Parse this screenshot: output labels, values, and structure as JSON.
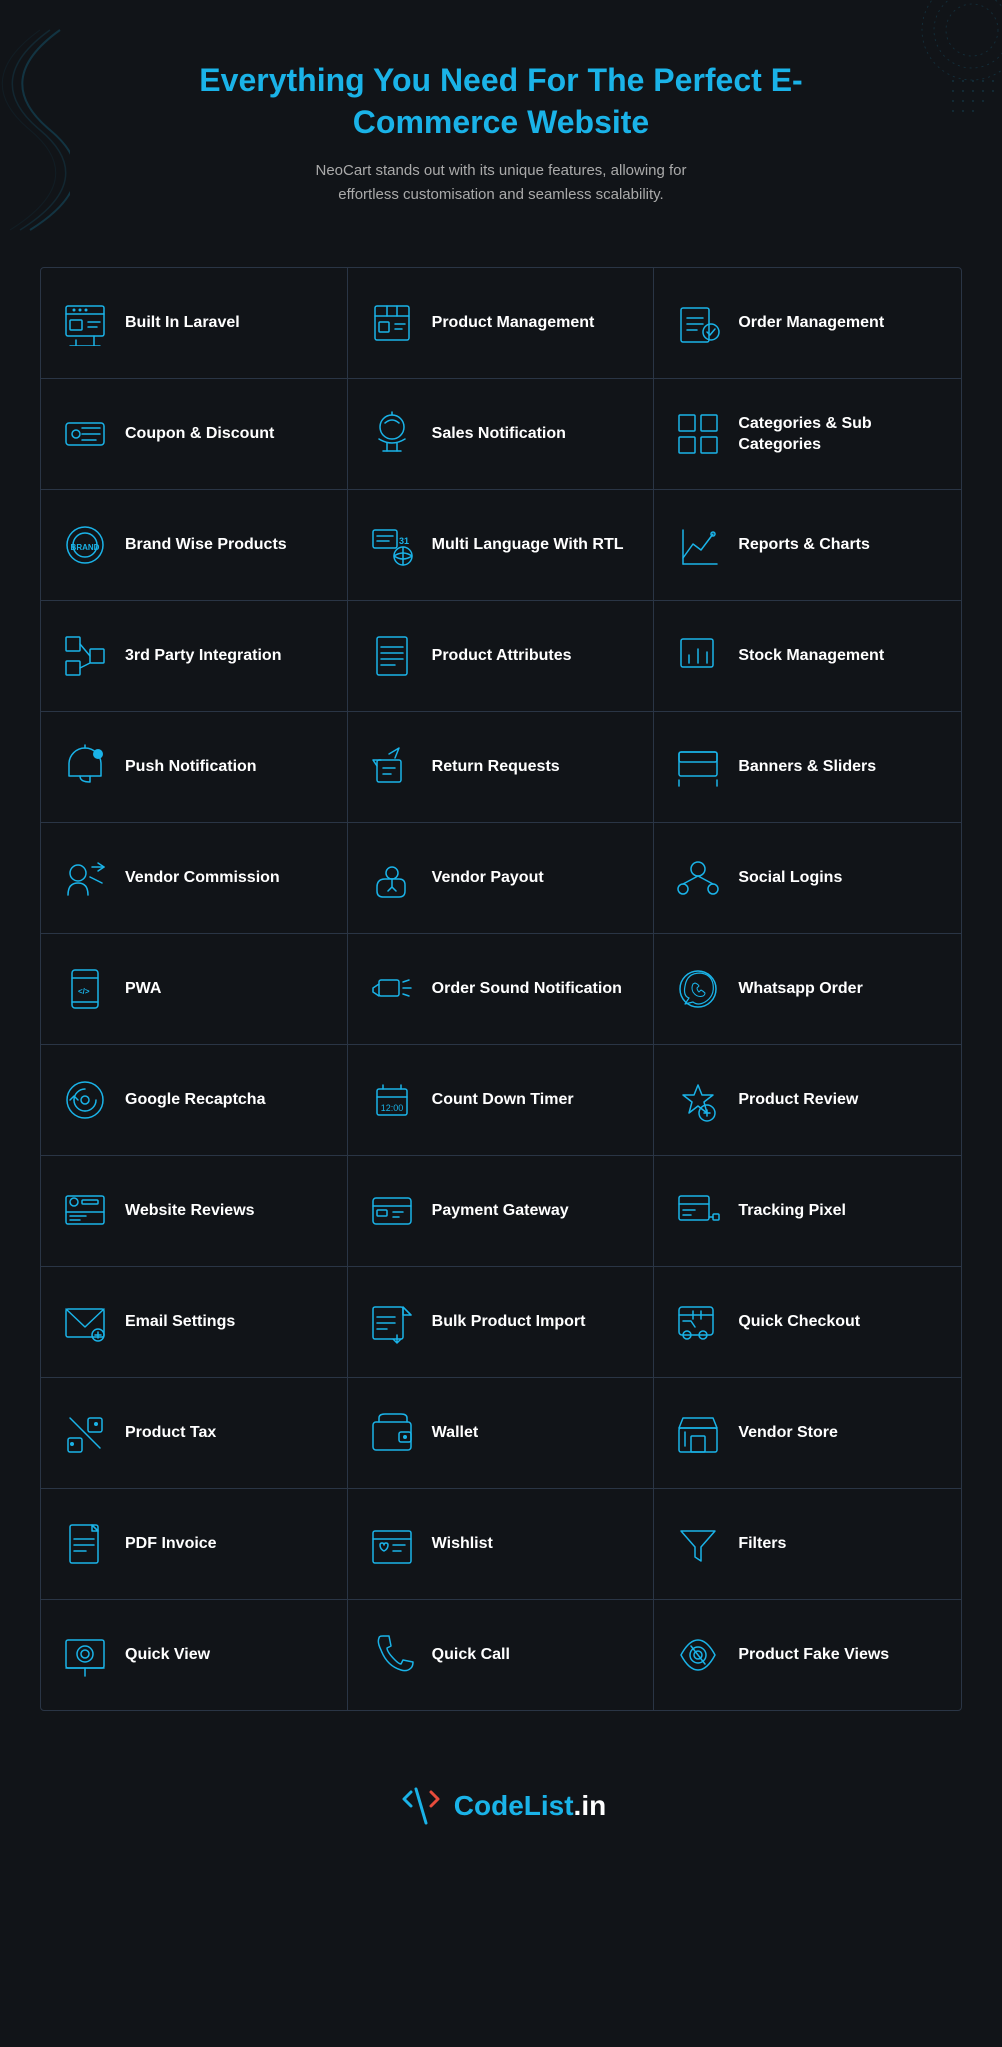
{
  "header": {
    "title": "Everything You Need For The Perfect E-Commerce Website",
    "subtitle": "NeoCart stands out with its unique features, allowing for effortless customisation and seamless scalability."
  },
  "features": [
    [
      {
        "label": "Built In Laravel",
        "icon": "laravel"
      },
      {
        "label": "Product Management",
        "icon": "product-management"
      },
      {
        "label": "Order Management",
        "icon": "order-management"
      }
    ],
    [
      {
        "label": "Coupon & Discount",
        "icon": "coupon"
      },
      {
        "label": "Sales Notification",
        "icon": "sales-notification"
      },
      {
        "label": "Categories & Sub Categories",
        "icon": "categories"
      }
    ],
    [
      {
        "label": "Brand Wise Products",
        "icon": "brand"
      },
      {
        "label": "Multi Language With RTL",
        "icon": "multilanguage"
      },
      {
        "label": "Reports & Charts",
        "icon": "reports"
      }
    ],
    [
      {
        "label": "3rd Party Integration",
        "icon": "integration"
      },
      {
        "label": "Product Attributes",
        "icon": "attributes"
      },
      {
        "label": "Stock Management",
        "icon": "stock"
      }
    ],
    [
      {
        "label": "Push Notification",
        "icon": "push-notification"
      },
      {
        "label": "Return Requests",
        "icon": "return"
      },
      {
        "label": "Banners & Sliders",
        "icon": "banners"
      }
    ],
    [
      {
        "label": "Vendor Commission",
        "icon": "vendor-commission"
      },
      {
        "label": "Vendor Payout",
        "icon": "vendor-payout"
      },
      {
        "label": "Social Logins",
        "icon": "social-logins"
      }
    ],
    [
      {
        "label": "PWA",
        "icon": "pwa"
      },
      {
        "label": "Order Sound Notification",
        "icon": "order-sound"
      },
      {
        "label": "Whatsapp Order",
        "icon": "whatsapp"
      }
    ],
    [
      {
        "label": "Google Recaptcha",
        "icon": "recaptcha"
      },
      {
        "label": "Count Down Timer",
        "icon": "countdown"
      },
      {
        "label": "Product Review",
        "icon": "review"
      }
    ],
    [
      {
        "label": "Website Reviews",
        "icon": "website-reviews"
      },
      {
        "label": "Payment Gateway",
        "icon": "payment"
      },
      {
        "label": "Tracking Pixel",
        "icon": "tracking"
      }
    ],
    [
      {
        "label": "Email Settings",
        "icon": "email"
      },
      {
        "label": "Bulk Product Import",
        "icon": "bulk-import"
      },
      {
        "label": "Quick Checkout",
        "icon": "quick-checkout"
      }
    ],
    [
      {
        "label": "Product Tax",
        "icon": "tax"
      },
      {
        "label": "Wallet",
        "icon": "wallet"
      },
      {
        "label": "Vendor Store",
        "icon": "vendor-store"
      }
    ],
    [
      {
        "label": "PDF Invoice",
        "icon": "pdf"
      },
      {
        "label": "Wishlist",
        "icon": "wishlist"
      },
      {
        "label": "Filters",
        "icon": "filters"
      }
    ],
    [
      {
        "label": "Quick View",
        "icon": "quick-view"
      },
      {
        "label": "Quick Call",
        "icon": "quick-call"
      },
      {
        "label": "Product Fake Views",
        "icon": "fake-views"
      }
    ]
  ],
  "footer": {
    "logo_text": "CodeList",
    "logo_domain": ".in"
  }
}
